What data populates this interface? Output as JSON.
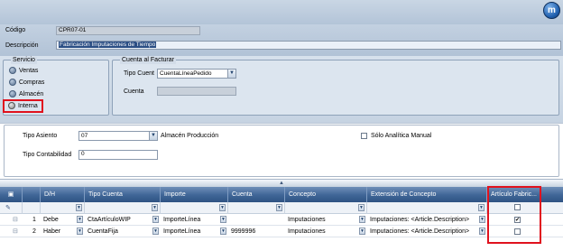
{
  "header": {
    "codigo_label": "Código",
    "codigo_value": "CPR07-01",
    "descripcion_label": "Descripción",
    "descripcion_value": "Fabricación Imputaciones de Tiempo",
    "logo_icon": "app-logo-icon"
  },
  "servicio": {
    "title": "Servicio",
    "options": [
      "Ventas",
      "Compras",
      "Almacén",
      "Interna"
    ],
    "selected": "Interna"
  },
  "cuenta_facturar": {
    "title": "Cuenta al Facturar",
    "tipo_cuenta_label": "Tipo Cuent",
    "tipo_cuenta_value": "CuentaLíneaPedido",
    "cuenta_label": "Cuenta",
    "cuenta_value": ""
  },
  "asiento": {
    "tipo_asiento_label": "Tipo Asiento",
    "tipo_asiento_value": "07",
    "tipo_asiento_desc": "Almacén Producción",
    "solo_analitica_label": "Sólo Analítica Manual",
    "tipo_contabilidad_label": "Tipo Contabilidad",
    "tipo_contabilidad_value": "0"
  },
  "grid": {
    "columns": [
      "D/H",
      "Tipo Cuenta",
      "Importe",
      "Cuenta",
      "Concepto",
      "Extensión de Concepto",
      "Artículo Fabric..."
    ],
    "rows": [
      {
        "num": "1",
        "dh": "Debe",
        "tipo_cuenta": "CtaArtículoWIP",
        "importe": "ImporteLínea",
        "cuenta": "",
        "concepto": "Imputaciones",
        "extension": "Imputaciones: <Article.Description>",
        "articulo_fabric": true
      },
      {
        "num": "2",
        "dh": "Haber",
        "tipo_cuenta": "CuentaFija",
        "importe": "ImporteLínea",
        "cuenta": "9999996",
        "concepto": "Imputaciones",
        "extension": "Imputaciones: <Article.Description>",
        "articulo_fabric": false
      }
    ]
  },
  "colors": {
    "header_bg": "#b9c9dc",
    "grid_header": "#3f6596",
    "highlight_red": "#e0121e"
  }
}
